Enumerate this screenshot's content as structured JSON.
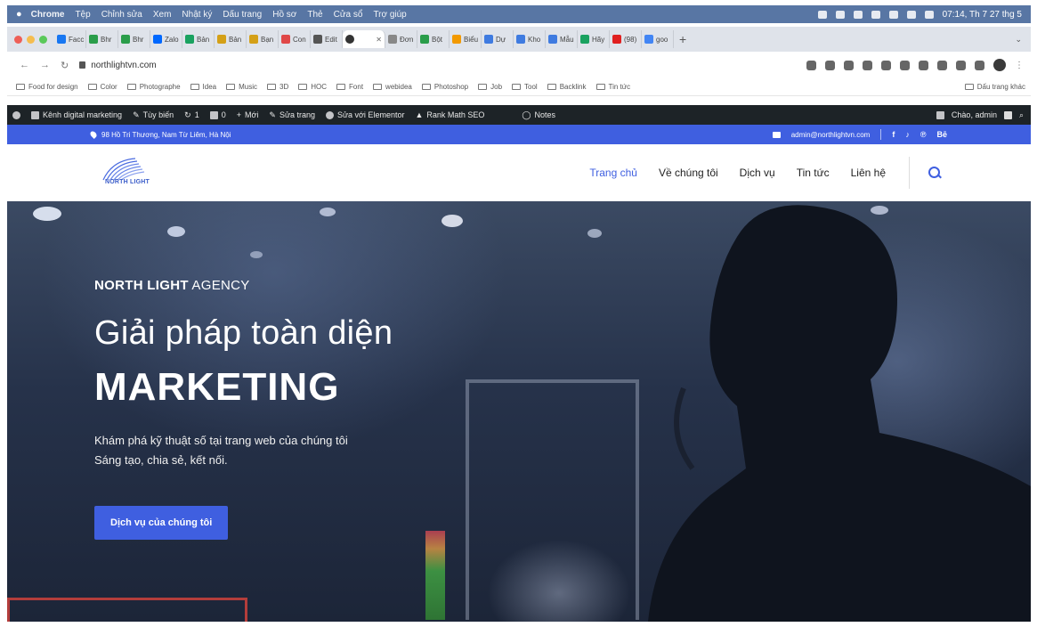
{
  "menubar": {
    "items": [
      "Chrome",
      "Tệp",
      "Chỉnh sửa",
      "Xem",
      "Nhật ký",
      "Dấu trang",
      "Hồ sơ",
      "Thẻ",
      "Cửa sổ",
      "Trợ giúp"
    ],
    "clock": "07:14, Th 7 27 thg 5"
  },
  "tabs": [
    "Facc",
    "Bhr",
    "Bhr",
    "Zalo",
    "Bản",
    "Bản",
    "Bạn",
    "Con",
    "Edit",
    "",
    "Đơn",
    "Bột",
    "Biểu",
    "Dự",
    "Kho",
    "Mẫu",
    "Hãy",
    "(98)",
    "goo"
  ],
  "address": {
    "url": "northlightvn.com"
  },
  "bookmarks": [
    "Food for design",
    "Color",
    "Photographe",
    "Idea",
    "Music",
    "3D",
    "HOC",
    "Font",
    "webidea",
    "Photoshop",
    "Job",
    "Tool",
    "Backlink",
    "Tin tức"
  ],
  "bookmarks_right": "Dấu trang khác",
  "wpbar": {
    "site": "Kênh digital marketing",
    "customize": "Tùy biến",
    "updates": "1",
    "comments": "0",
    "new": "Mới",
    "edit": "Sửa trang",
    "elementor": "Sửa với Elementor",
    "rankmath": "Rank Math SEO",
    "notes": "Notes",
    "greeting": "Chào, admin"
  },
  "topbar": {
    "address": "98 Hồ Tri Thương, Nam Từ Liêm, Hà Nội",
    "email": "admin@northlightvn.com",
    "social_be": "Bē"
  },
  "header": {
    "logo_text": "NORTH LIGHT",
    "nav": [
      "Trang chủ",
      "Về chúng tôi",
      "Dịch vụ",
      "Tin tức",
      "Liên hệ"
    ]
  },
  "hero": {
    "agency_bold": "NORTH LIGHT",
    "agency_rest": " AGENCY",
    "title_line1": "Giải pháp toàn diện",
    "title_line2": "MARKETING",
    "desc_line1": "Khám phá kỹ thuật số tại trang web của chúng tôi",
    "desc_line2": "Sáng tạo, chia sẻ, kết nối.",
    "cta": "Dịch vụ của chúng tôi"
  },
  "colors": {
    "brand": "#3f5fe0",
    "wpbar": "#1d2327",
    "macbar": "#5876a4"
  }
}
